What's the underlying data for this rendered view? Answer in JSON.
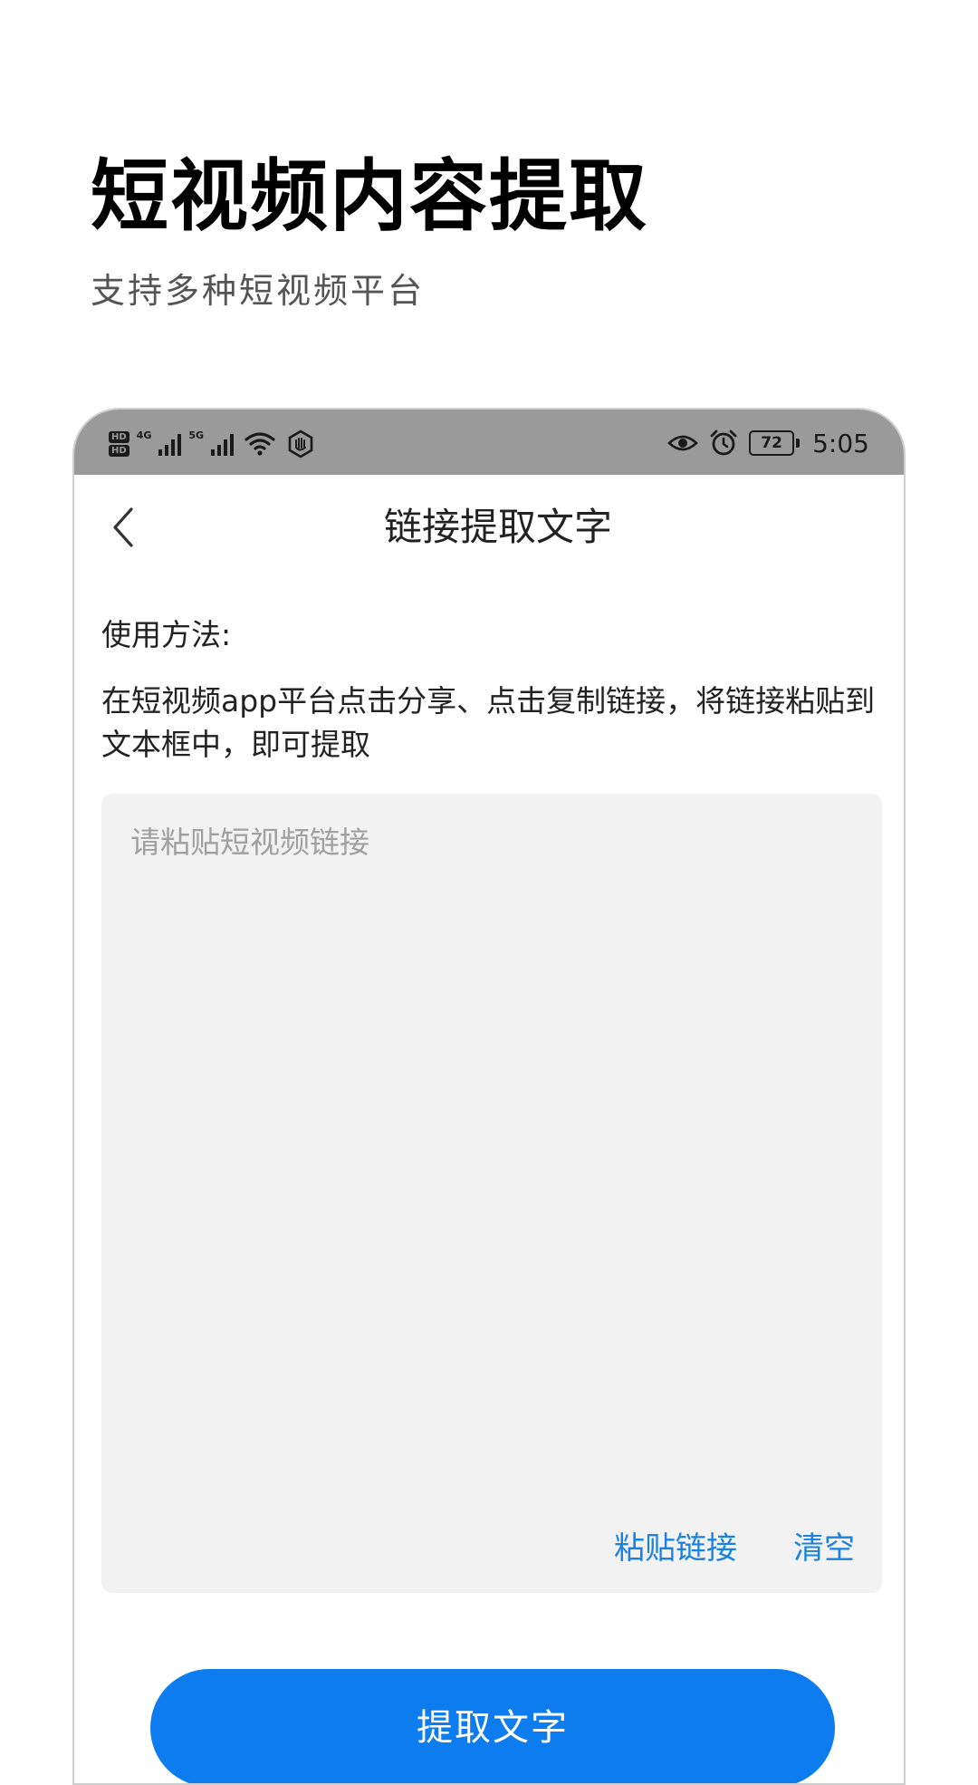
{
  "promo": {
    "title": "短视频内容提取",
    "subtitle": "支持多种短视频平台"
  },
  "status_bar": {
    "hd1": "HD",
    "hd2": "HD",
    "net1": "4G",
    "net2": "5G",
    "battery": "72",
    "time": "5:05"
  },
  "nav": {
    "title": "链接提取文字"
  },
  "instructions": {
    "label": "使用方法:",
    "text": "在短视频app平台点击分享、点击复制链接，将链接粘贴到文本框中，即可提取"
  },
  "link_input": {
    "value": "",
    "placeholder": "请粘贴短视频链接"
  },
  "link_actions": {
    "paste": "粘贴链接",
    "clear": "清空"
  },
  "extract_button": {
    "label": "提取文字"
  },
  "colors": {
    "accent": "#0c7cee",
    "link": "#1a82e0",
    "status_bar": "#9a9a9a",
    "input_bg": "#f2f2f2"
  }
}
